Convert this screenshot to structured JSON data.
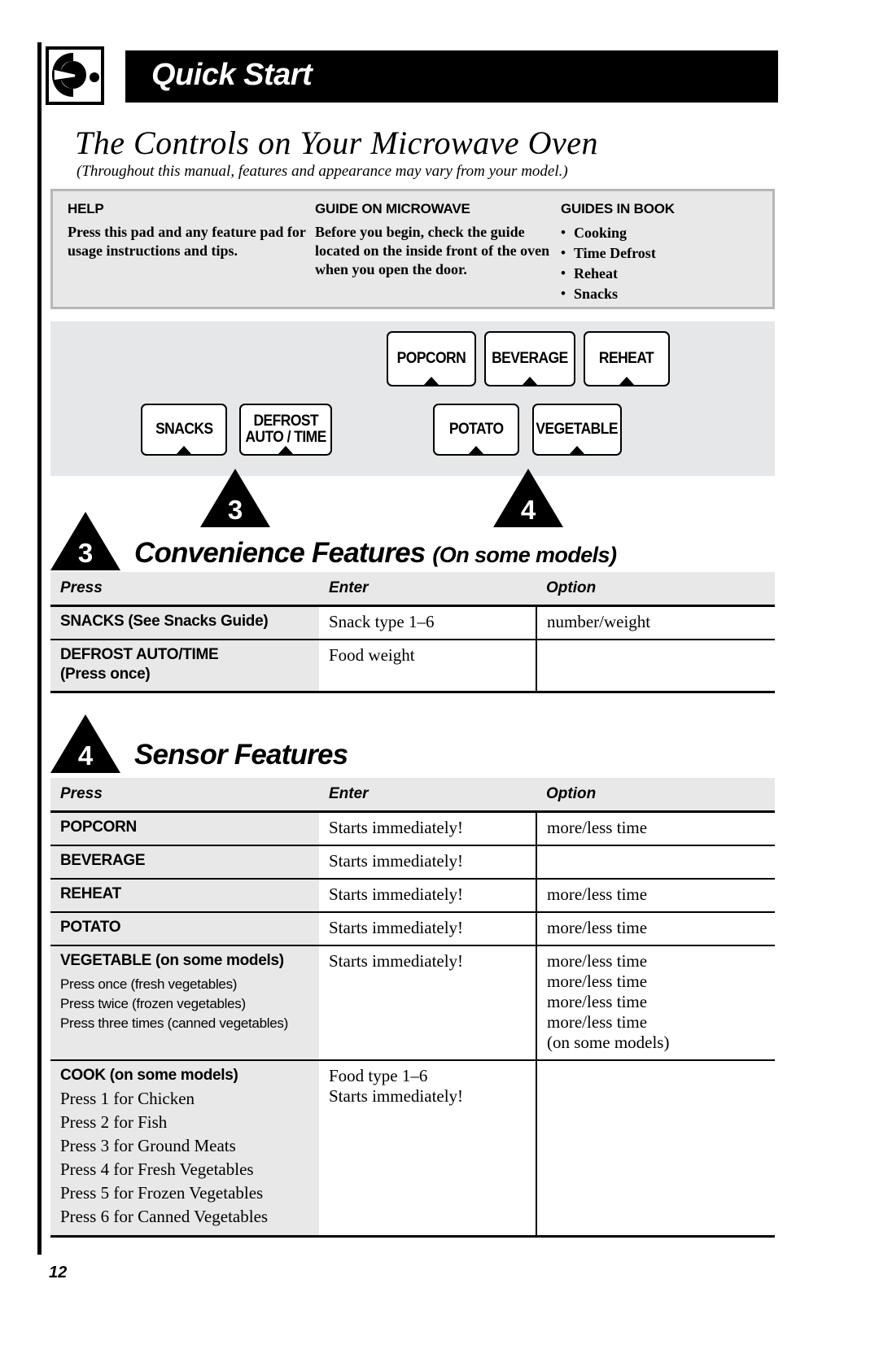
{
  "header": {
    "icon": "microwave-dial-icon",
    "title": "Quick Start"
  },
  "section": {
    "title": "The Controls on Your Microwave Oven",
    "subtitle": "(Throughout this manual, features and appearance may vary from your model.)"
  },
  "info_panel": {
    "columns": [
      {
        "heading": "HELP",
        "body": "Press this pad and any feature pad for usage instructions and tips.",
        "bullets": []
      },
      {
        "heading": "GUIDE ON MICROWAVE",
        "body": "Before you begin, check the guide located on the inside front of the oven when you open the door.",
        "bullets": []
      },
      {
        "heading": "GUIDES IN BOOK",
        "body": "",
        "bullets": [
          "Cooking",
          "Time Defrost",
          "Reheat",
          "Snacks"
        ]
      }
    ]
  },
  "keypad": {
    "pads": [
      {
        "label": "POPCORN",
        "label_line2": ""
      },
      {
        "label": "BEVERAGE",
        "label_line2": ""
      },
      {
        "label": "REHEAT",
        "label_line2": ""
      },
      {
        "label": "SNACKS",
        "label_line2": ""
      },
      {
        "label": "DEFROST",
        "label_line2": "AUTO / TIME"
      },
      {
        "label": "POTATO",
        "label_line2": ""
      },
      {
        "label": "VEGETABLE",
        "label_line2": ""
      }
    ],
    "callouts": [
      {
        "number": "3"
      },
      {
        "number": "4"
      }
    ]
  },
  "convenience": {
    "marker": "3",
    "title": "Convenience Features",
    "title_suffix": "(On some models)",
    "headers": [
      "Press",
      "Enter",
      "Option"
    ],
    "rows": [
      {
        "press_main": "SNACKS (See Snacks Guide)",
        "press_sub": [],
        "enter": "Snack type 1–6",
        "option": "number/weight"
      },
      {
        "press_main": "DEFROST AUTO/TIME",
        "press_sub": [
          "(Press once)"
        ],
        "enter": "Food weight",
        "option": ""
      }
    ]
  },
  "sensor": {
    "marker": "4",
    "title": "Sensor Features",
    "title_suffix": "",
    "headers": [
      "Press",
      "Enter",
      "Option"
    ],
    "rows": [
      {
        "press_main": "POPCORN",
        "press_sub": [],
        "enter": "Starts immediately!",
        "option": "more/less time"
      },
      {
        "press_main": "BEVERAGE",
        "press_sub": [],
        "enter": "Starts immediately!",
        "option": ""
      },
      {
        "press_main": "REHEAT",
        "press_sub": [],
        "enter": "Starts immediately!",
        "option": "more/less time"
      },
      {
        "press_main": "POTATO",
        "press_sub": [],
        "enter": "Starts immediately!",
        "option": "more/less time"
      },
      {
        "press_main": "VEGETABLE (on some models)",
        "press_sub": [
          "Press once (fresh vegetables)",
          "Press twice (frozen vegetables)",
          "Press three times (canned vegetables)"
        ],
        "enter": "Starts immediately!",
        "option": "more/less time\nmore/less time\nmore/less time\nmore/less time\n(on some models)"
      },
      {
        "press_main": "COOK (on some models)",
        "press_sub_serif": [
          "Press 1 for Chicken",
          "Press 2 for Fish",
          "Press 3 for Ground Meats",
          "Press 4 for Fresh Vegetables",
          "Press 5 for Frozen Vegetables",
          "Press 6 for Canned Vegetables"
        ],
        "enter": "Food type 1–6\nStarts immediately!",
        "option": ""
      }
    ]
  },
  "footer": {
    "page_number": "12"
  },
  "colors": {
    "panel_gray": "#e8e8e8",
    "keypad_gray": "#e6e7e8",
    "border_gray": "#b6b6b6",
    "ink": "#000000",
    "paper": "#ffffff"
  }
}
